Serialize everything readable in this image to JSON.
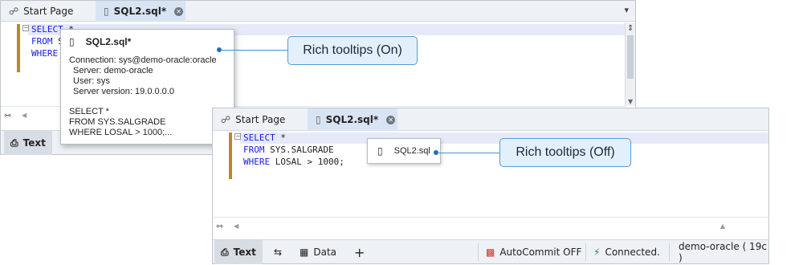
{
  "window_back": {
    "tabs": [
      {
        "label": "Start Page",
        "icon": "start-page-icon"
      },
      {
        "label": "SQL2.sql*",
        "icon": "sql-file-icon",
        "close": "✕"
      }
    ],
    "dropdown_glyph": "▾",
    "code_lines": [
      {
        "kw": "SELECT",
        "rest": " *"
      },
      {
        "kw": "FROM",
        "rest": " S"
      },
      {
        "kw": "WHERE",
        "rest": ""
      }
    ],
    "toolbar": {
      "text_label": "Text"
    }
  },
  "rich_tooltip": {
    "title": "SQL2.sql*",
    "connection": "Connection: sys@demo-oracle:oracle",
    "server": "Server: demo-oracle",
    "user": "User: sys",
    "version": "Server version: 19.0.0.0.0",
    "sql_lines": [
      "SELECT *",
      "FROM SYS.SALGRADE",
      "WHERE LOSAL > 1000;..."
    ]
  },
  "window_front": {
    "tabs": [
      {
        "label": "Start Page",
        "icon": "start-page-icon"
      },
      {
        "label": "SQL2.sql*",
        "icon": "sql-file-icon",
        "close": "✕"
      }
    ],
    "code_lines": [
      {
        "kw": "SELECT",
        "rest": " *"
      },
      {
        "kw": "FROM",
        "rest": " SYS.SALGRADE"
      },
      {
        "kw": "WHERE",
        "rest": " LOSAL > 1000;"
      }
    ],
    "plain_tooltip": "SQL2.sql",
    "toolbar": {
      "text_label": "Text",
      "data_label": "Data",
      "add_glyph": "+",
      "autocommit": "AutoCommit OFF",
      "connected": "Connected.",
      "connection": "demo-oracle ( 19c )"
    }
  },
  "callouts": {
    "on": "Rich tooltips (On)",
    "off": "Rich tooltips (Off)"
  },
  "colors": {
    "keyword": "#1a1ae6",
    "accent_bar": "#b8892a",
    "callout_border": "#5a9bd1",
    "callout_fill": "#e3effa"
  }
}
